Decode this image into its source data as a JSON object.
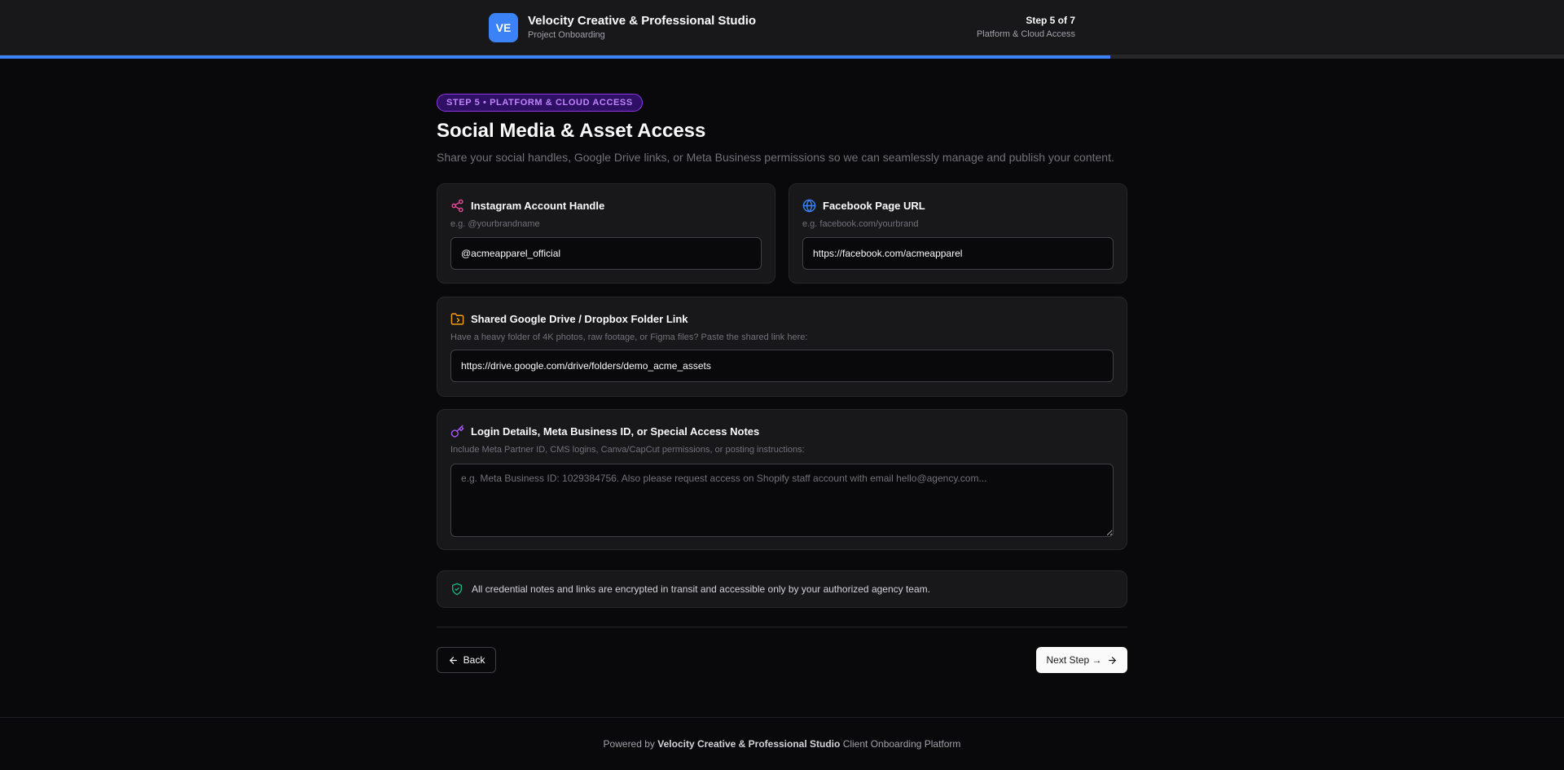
{
  "header": {
    "logo_initials": "VE",
    "brand_name": "Velocity Creative & Professional Studio",
    "brand_subtitle": "Project Onboarding",
    "step_count": "Step 5 of 7",
    "step_name": "Platform & Cloud Access",
    "progress": 0.71
  },
  "main": {
    "step_pill": "STEP 5 • PLATFORM & CLOUD ACCESS",
    "title": "Social Media & Asset Access",
    "subtitle": "Share your social handles, Google Drive links, or Meta Business permissions so we can seamlessly manage and publish your content."
  },
  "instagram": {
    "label": "Instagram Account Handle",
    "help": "e.g. @yourbrandname",
    "value": "@acmeapparel_official",
    "icon": "share-icon"
  },
  "facebook": {
    "label": "Facebook Page URL",
    "help": "e.g. facebook.com/yourbrand",
    "value": "https://facebook.com/acmeapparel",
    "icon": "globe-icon"
  },
  "drive": {
    "label": "Shared Google Drive / Dropbox Folder Link",
    "help": "Have a heavy folder of 4K photos, raw footage, or Figma files? Paste the shared link here:",
    "value": "https://drive.google.com/drive/folders/demo_acme_assets",
    "icon": "folder-icon"
  },
  "notes": {
    "label": "Login Details, Meta Business ID, or Special Access Notes",
    "help": "Include Meta Partner ID, CMS logins, Canva/CapCut permissions, or posting instructions:",
    "placeholder": "e.g. Meta Business ID: 1029384756. Also please request access on Shopify staff account with email hello@agency.com...",
    "value": "",
    "icon": "key-icon"
  },
  "notice": {
    "text": "All credential notes and links are encrypted in transit and accessible only by your authorized agency team.",
    "icon": "shield-check-icon"
  },
  "actions": {
    "back_label": "Back",
    "next_label": "Next Step →"
  },
  "footer": {
    "prefix": "Powered by",
    "brand": "Velocity Creative & Professional Studio",
    "suffix": "Client Onboarding Platform"
  },
  "colors": {
    "accent": "#3b82f6",
    "pill": "#c084fc",
    "instagram_icon": "#ec4899",
    "facebook_icon": "#3b82f6",
    "drive_icon": "#f59e0b",
    "notes_icon": "#a855f7",
    "shield_icon": "#10b981"
  }
}
